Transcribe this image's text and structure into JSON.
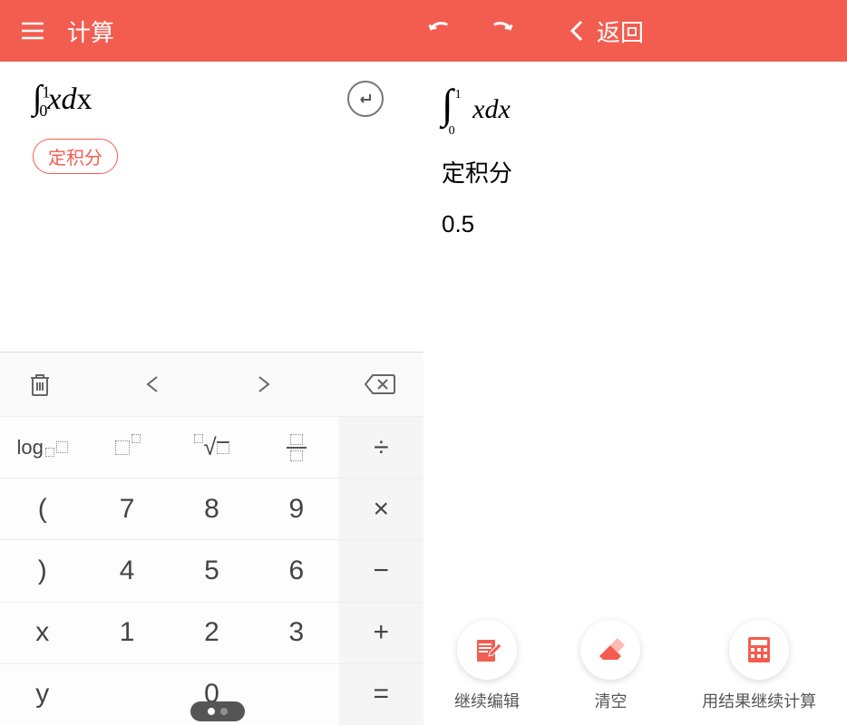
{
  "header": {
    "title": "计算",
    "back_label": "返回"
  },
  "left": {
    "expression_display": "∫₀¹ x dx",
    "tag_label": "定积分"
  },
  "right": {
    "expression_display": "∫₀¹ x dx",
    "result_label": "定积分",
    "result_value": "0.5"
  },
  "keypad": {
    "toolbar": {
      "delete": "trash",
      "prev": "◀",
      "next": "▶",
      "backspace": "⌫"
    },
    "rows": [
      [
        "log□□",
        "□^□",
        "□√□",
        "□/□",
        "÷"
      ],
      [
        "(",
        "7",
        "8",
        "9",
        "×"
      ],
      [
        ")",
        "4",
        "5",
        "6",
        "−"
      ],
      [
        "x",
        "1",
        "2",
        "3",
        "+"
      ],
      [
        "y",
        "",
        "0",
        "",
        "="
      ]
    ]
  },
  "actions": {
    "edit_label": "继续编辑",
    "clear_label": "清空",
    "continue_label": "用结果继续计算"
  }
}
